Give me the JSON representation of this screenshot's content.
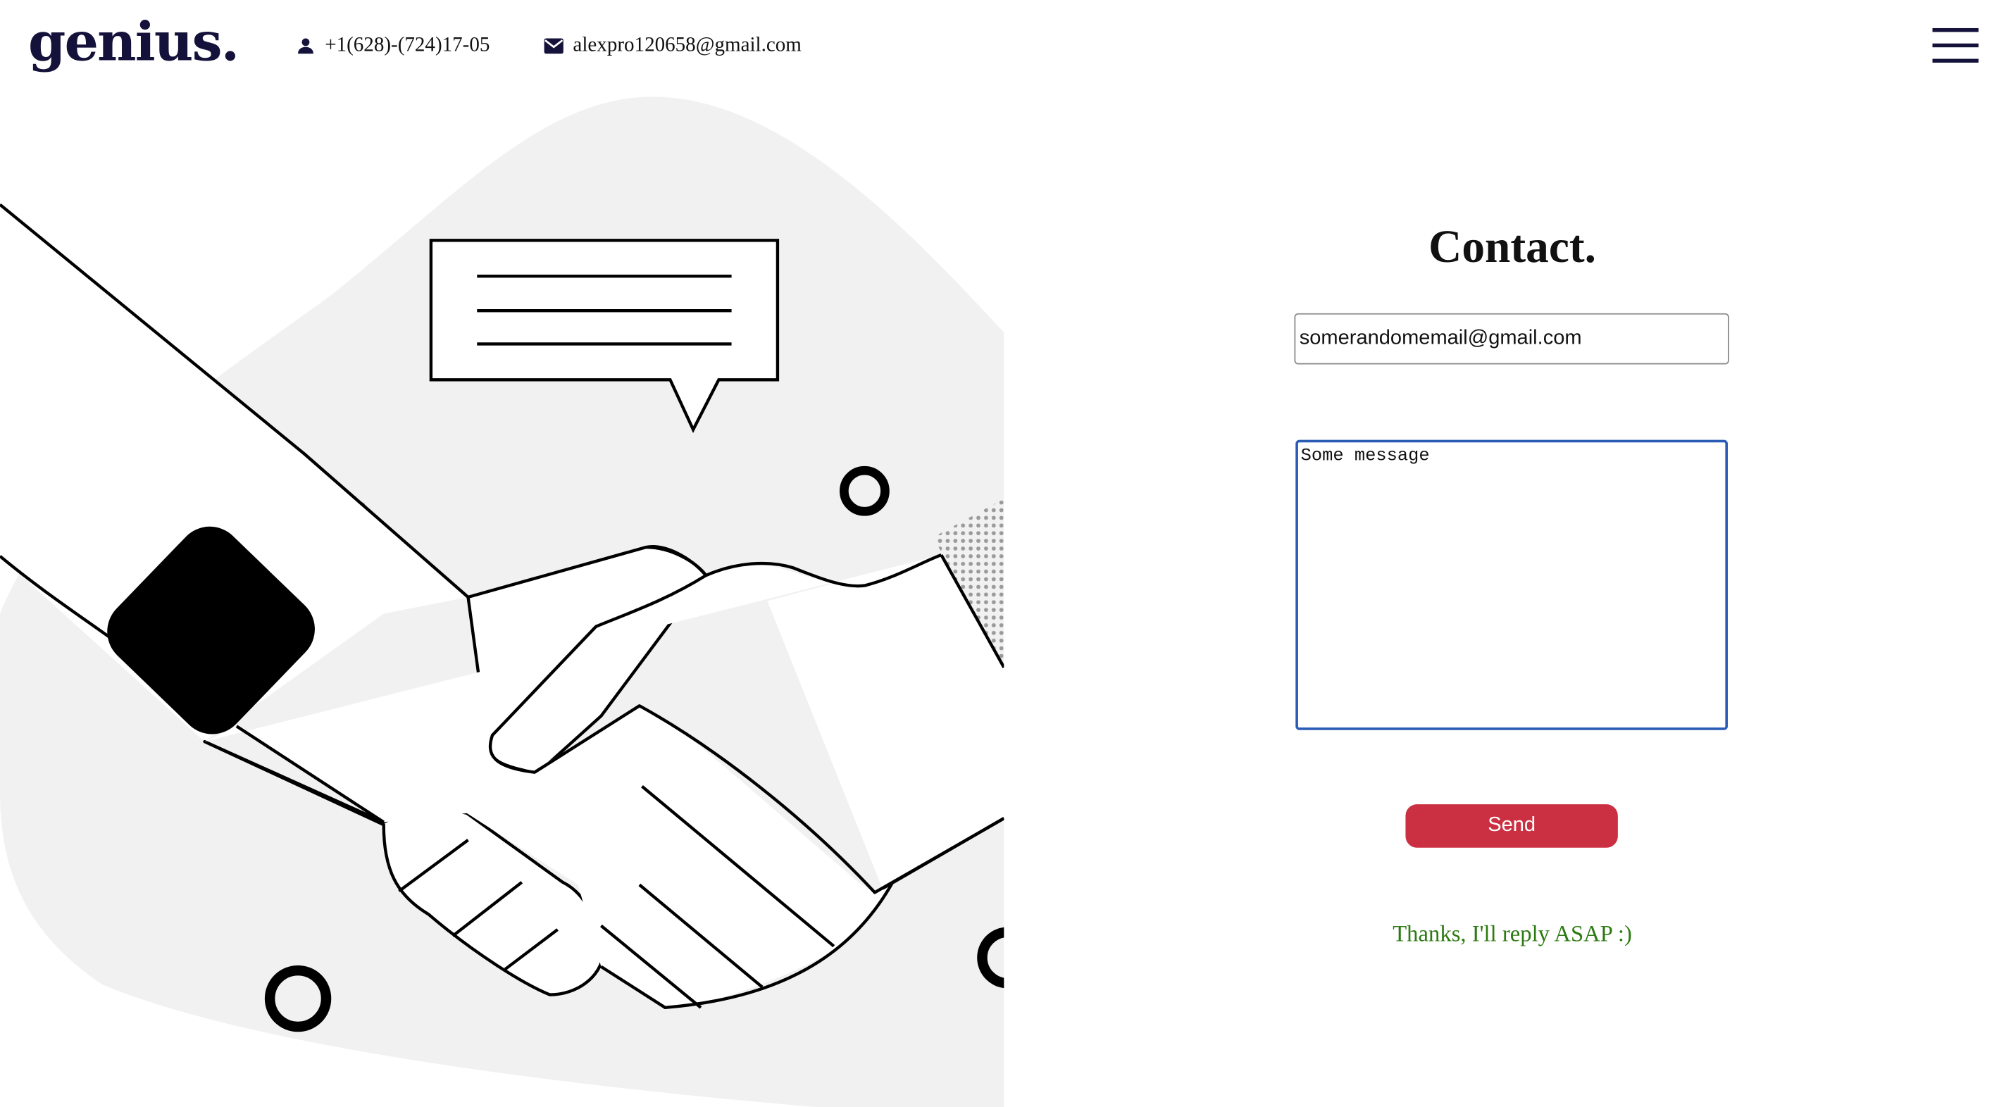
{
  "header": {
    "logo": "genius.",
    "phone": "+1(628)-(724)17-05",
    "email": "alexpro120658@gmail.com",
    "phone_icon": "person-icon",
    "email_icon": "envelope-icon",
    "menu_icon": "hamburger-menu-icon"
  },
  "contact_form": {
    "title": "Contact.",
    "email_value": "somerandomemail@gmail.com",
    "message_value": "Some message",
    "send_label": "Send",
    "confirmation": "Thanks, I'll reply ASAP :)"
  },
  "colors": {
    "brand": "#14123a",
    "send_button": "#cb2f42",
    "confirmation_text": "#2c7a12",
    "focus_border": "#2a5cb5",
    "blob": "#f1f1f1"
  }
}
